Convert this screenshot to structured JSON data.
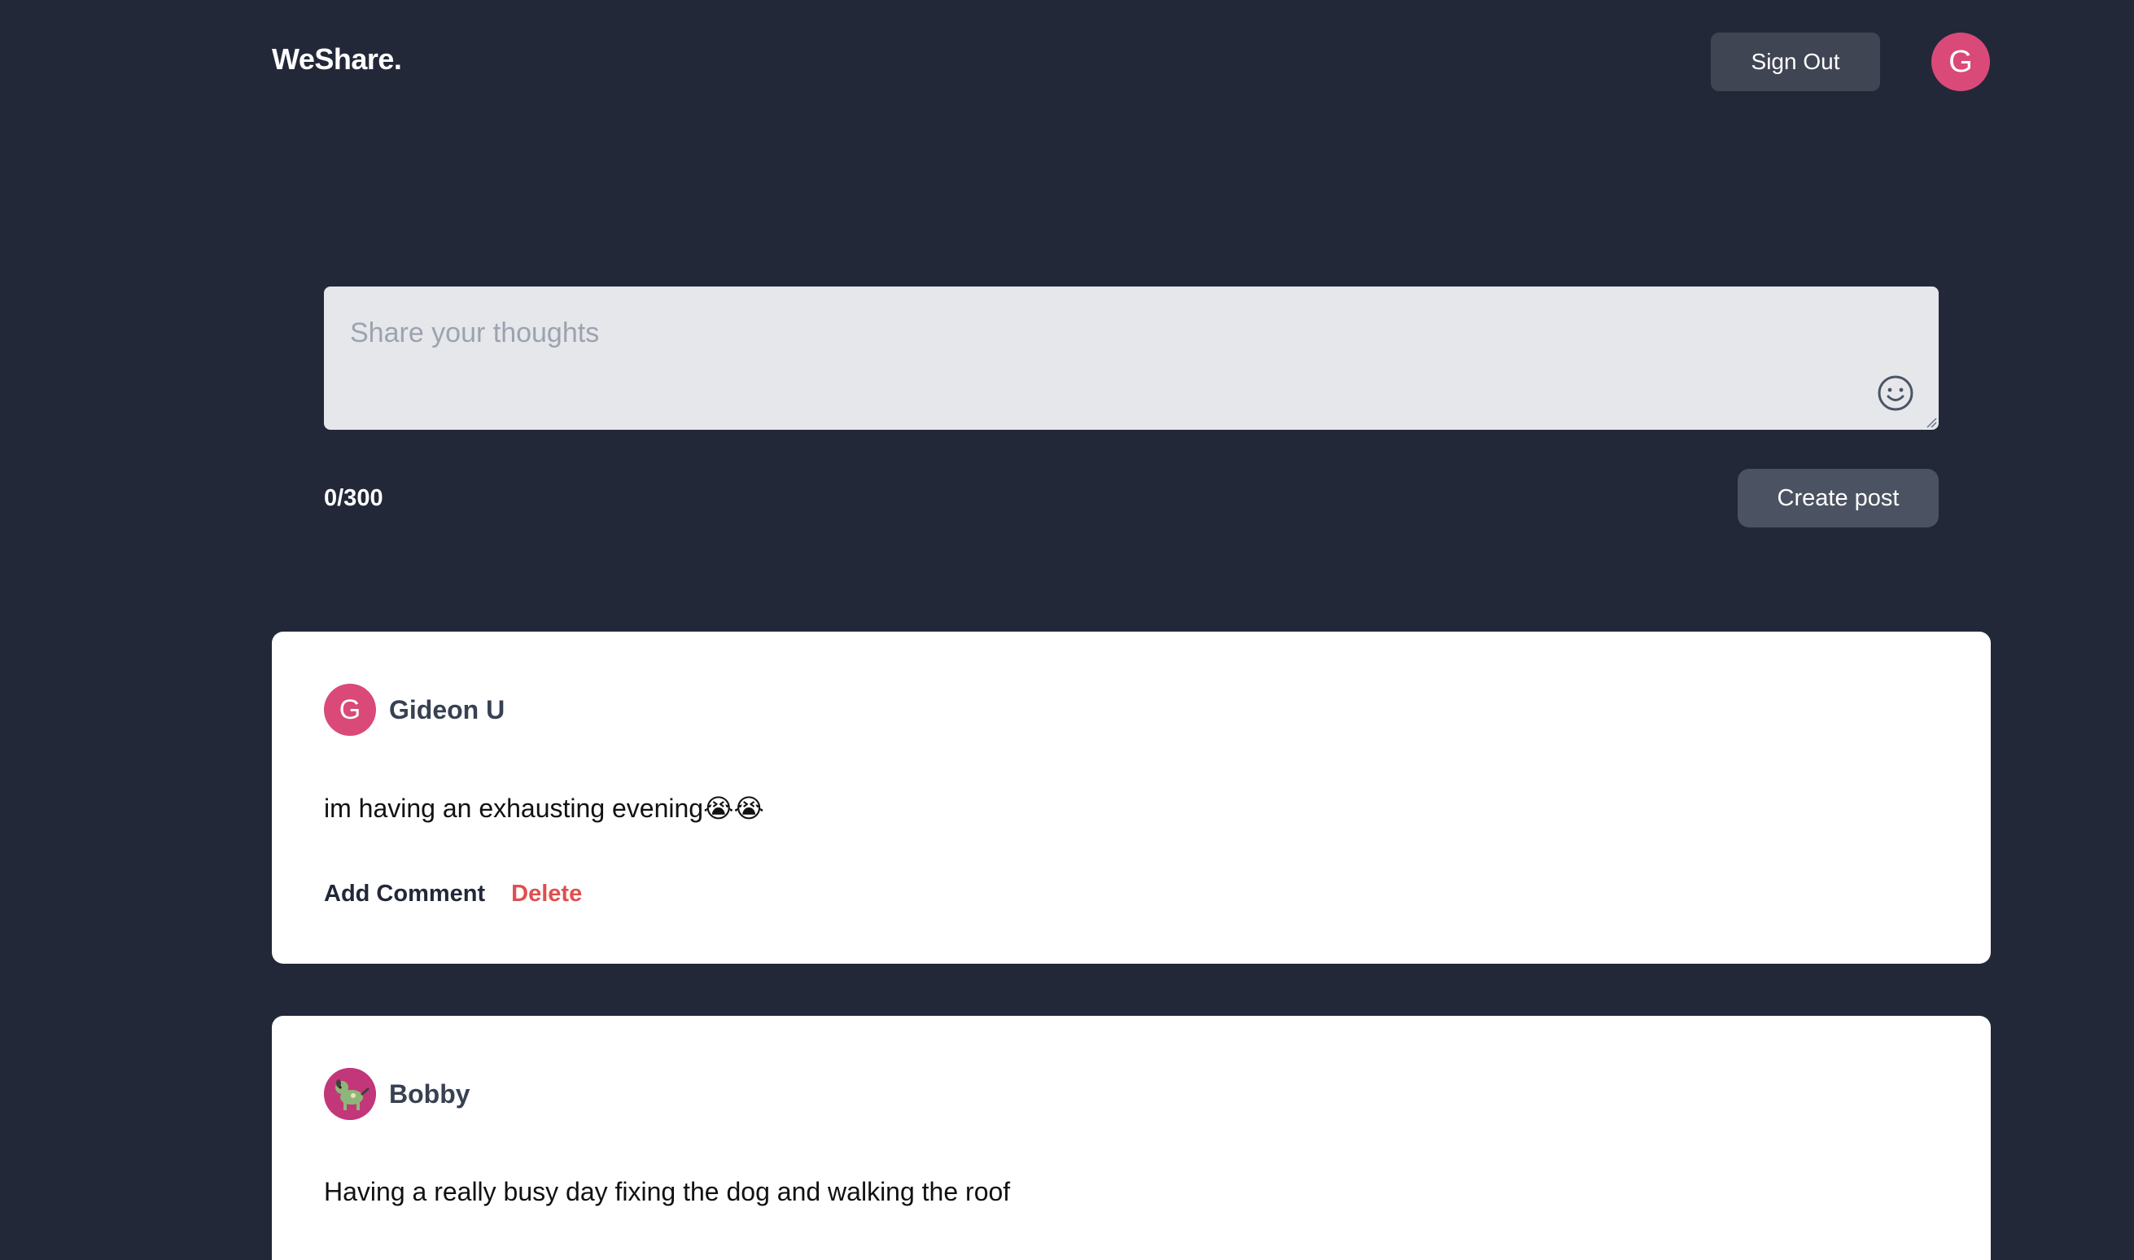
{
  "header": {
    "brand": "WeShare.",
    "sign_out_label": "Sign Out",
    "user_initial": "G"
  },
  "composer": {
    "placeholder": "Share your thoughts",
    "value": "",
    "emoji_icon": "smiley-face-icon",
    "char_count": "0/300",
    "create_label": "Create post"
  },
  "posts": [
    {
      "author_initial": "G",
      "author": "Gideon U",
      "body": "im having an exhausting evening😭😭",
      "add_comment_label": "Add Comment",
      "delete_label": "Delete"
    },
    {
      "author_avatar": "dog-avatar-icon",
      "author": "Bobby",
      "body": "Having a really busy day fixing the dog and walking the roof"
    }
  ],
  "colors": {
    "background": "#222838",
    "avatar_pink": "#d94a78",
    "delete_red": "#df4f4f",
    "button_gray": "#3f4553"
  }
}
